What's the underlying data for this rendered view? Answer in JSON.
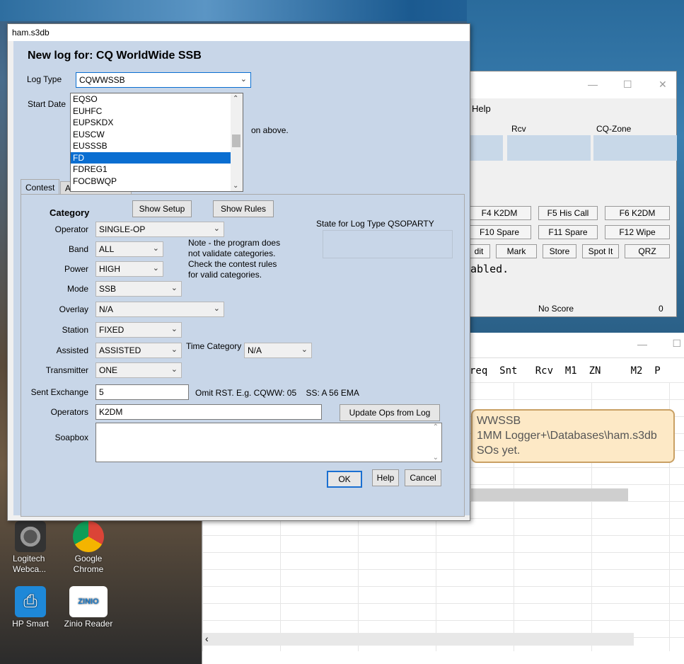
{
  "dialog": {
    "title": "ham.s3db",
    "heading": "New log for: CQ WorldWide SSB",
    "log_type_label": "Log Type",
    "log_type_value": "CQWWSSB",
    "start_date_label": "Start Date",
    "hint_fragment": "on above.",
    "dropdown_items": [
      "EQSO",
      "EUHFC",
      "EUPSKDX",
      "EUSCW",
      "EUSSSB",
      "FD",
      "FDREG1",
      "FOCBWQP"
    ],
    "dropdown_selected_index": 5,
    "tabs": [
      "Contest",
      "Associated Files"
    ],
    "active_tab": 0,
    "category_label": "Category",
    "show_setup": "Show Setup",
    "show_rules": "Show Rules",
    "state_label": "State for Log Type QSOPARTY",
    "operator_label": "Operator",
    "operator_value": "SINGLE-OP",
    "band_label": "Band",
    "band_value": "ALL",
    "power_label": "Power",
    "power_value": "HIGH",
    "mode_label": "Mode",
    "mode_value": "SSB",
    "overlay_label": "Overlay",
    "overlay_value": "N/A",
    "station_label": "Station",
    "station_value": "FIXED",
    "assisted_label": "Assisted",
    "assisted_value": "ASSISTED",
    "time_category_label": "Time Category",
    "time_category_value": "N/A",
    "transmitter_label": "Transmitter",
    "transmitter_value": "ONE",
    "note_lines": [
      "Note -  the program does",
      "not validate categories.",
      "Check the contest rules",
      "for valid categories."
    ],
    "sent_exchange_label": "Sent Exchange",
    "sent_exchange_value": "5",
    "exchange_hint": "Omit RST. E.g. CQWW: 05    SS: A 56 EMA",
    "operators_label": "Operators",
    "operators_value": "K2DM",
    "update_ops": "Update Ops from Log",
    "soapbox_label": "Soapbox",
    "ok": "OK",
    "help": "Help",
    "cancel": "Cancel"
  },
  "n1mm": {
    "menu_help": "Help",
    "col_rcv": "Rcv",
    "col_cqzone": "CQ-Zone",
    "fkeys_row1": [
      "F4 K2DM",
      "F5 His Call",
      "F6 K2DM"
    ],
    "fkeys_row2": [
      "F10 Spare",
      "F11 Spare",
      "F12 Wipe"
    ],
    "fkeys_row3": [
      "dit",
      "Mark",
      "Store",
      "Spot It",
      "QRZ"
    ],
    "mono_text": "abled.",
    "score": "No Score",
    "score_num": "0"
  },
  "log_window": {
    "header": "req  Snt   Rcv  M1  ZN     M2  P",
    "tooltip_lines": [
      "WWSSB",
      "1MM Logger+\\Databases\\ham.s3db",
      "SOs yet."
    ]
  },
  "desktop_icons": [
    {
      "label": "Logitech\nWebca...",
      "icon": "webcam-icon"
    },
    {
      "label": "Google\nChrome",
      "icon": "chrome-icon"
    },
    {
      "label": "HP Smart",
      "icon": "printer-icon"
    },
    {
      "label": "Zinio Reader",
      "icon": "zinio-icon",
      "badge": "ZINIO"
    }
  ],
  "colors": {
    "selection": "#0a6ed1",
    "dialog_bg": "#c8d6e8",
    "tooltip": "#fde9c6"
  }
}
